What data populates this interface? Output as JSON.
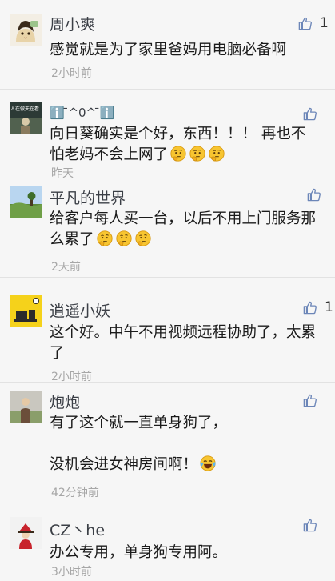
{
  "comments": [
    {
      "name": "周小爽",
      "text": "感觉就是为了家里爸妈用电脑必备啊",
      "time": "2小时前",
      "likes": "1"
    },
    {
      "name": "ℹ️ ̄^0^ ̄ℹ️",
      "avatar_caption": "人在做天在看",
      "text": "向日葵确实是个好，东西！！！ 再也不怕老妈不会上网了",
      "emoji": [
        "thinking-face-icon",
        "thinking-face-icon",
        "thinking-face-icon"
      ],
      "time": "昨天"
    },
    {
      "name": "平凡的世界",
      "text": "给客户每人买一台，以后不用上门服务那么累了",
      "emoji": [
        "thinking-face-icon",
        "thinking-face-icon",
        "thinking-face-icon"
      ],
      "time": "2天前"
    },
    {
      "name": "逍遥小妖",
      "text": "这个好。中午不用视频远程协助了，太累了",
      "time": "2小时前",
      "likes": "1"
    },
    {
      "name": "炮炮",
      "text": "有了这个就一直单身狗了，",
      "text2": "没机会进女神房间啊！",
      "emoji": [
        "tears-of-joy-icon"
      ],
      "time": "42分钟前"
    },
    {
      "name": "CZ丶he",
      "text": "办公专用，单身狗专用阿。",
      "time": "3小时前"
    }
  ],
  "colors": {
    "like_icon": "#6c86b8",
    "time": "#a7a7a7",
    "divider": "#e2e2e2"
  }
}
